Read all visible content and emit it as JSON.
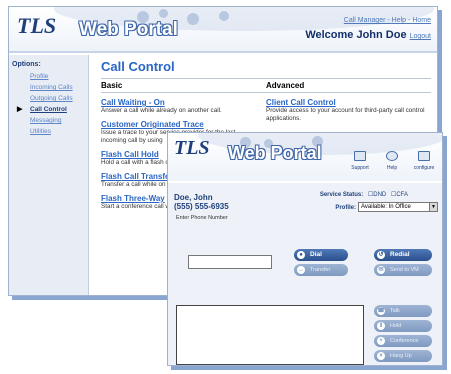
{
  "back_window": {
    "logo": "TLS",
    "brand": "Web Portal",
    "top_links": [
      "Call Manager",
      "Help",
      "Home"
    ],
    "welcome": "Welcome John Doe",
    "logout": "Logout",
    "sidebar": {
      "title": "Options:",
      "items": [
        {
          "label": "Profile",
          "active": false
        },
        {
          "label": "Incoming Calls",
          "active": false
        },
        {
          "label": "Outgoing Calls",
          "active": false
        },
        {
          "label": "Call Control",
          "active": true
        },
        {
          "label": "Messaging",
          "active": false
        },
        {
          "label": "Utilities",
          "active": false
        }
      ]
    },
    "page_title": "Call Control",
    "col_basic": "Basic",
    "col_advanced": "Advanced",
    "basic_features": [
      {
        "title": "Call Waiting - On",
        "desc": "Answer a call while already on another call."
      },
      {
        "title": "Customer Originated Trace",
        "desc": "Issue a trace to your service provider for the last incoming call by using"
      },
      {
        "title": "Flash Call Hold",
        "desc": "Hold a call with a flash on a simple phone without"
      },
      {
        "title": "Flash Call Transfer",
        "desc": "Transfer a call while on a call control capability."
      },
      {
        "title": "Flash Three-Way",
        "desc": "Start a conference call without call control ca"
      }
    ],
    "advanced_features": [
      {
        "title": "Client Call Control",
        "desc": "Provide access to your account for third-party call control applications."
      }
    ]
  },
  "front_window": {
    "logo": "TLS",
    "brand": "Web Portal",
    "toolbar": [
      {
        "label": "Support",
        "icon": "support-icon"
      },
      {
        "label": "Help",
        "icon": "help-icon"
      },
      {
        "label": "configure",
        "icon": "configure-icon"
      }
    ],
    "user_name": "Doe, John",
    "user_phone": "(555) 555-6935",
    "service_status_label": "Service Status:",
    "service_options": [
      "DND",
      "CFA"
    ],
    "profile_label": "Profile:",
    "profile_value": "Available: In Office",
    "enter_phone_label": "Enter Phone Number",
    "phone_value": "",
    "buttons": {
      "dial": "Dial",
      "transfer": "Transfer",
      "redial": "Redial",
      "send_to_vm": "Send to VM",
      "talk": "Talk",
      "hold": "Hold",
      "conference": "Conference",
      "hang_up": "Hang Up"
    }
  }
}
